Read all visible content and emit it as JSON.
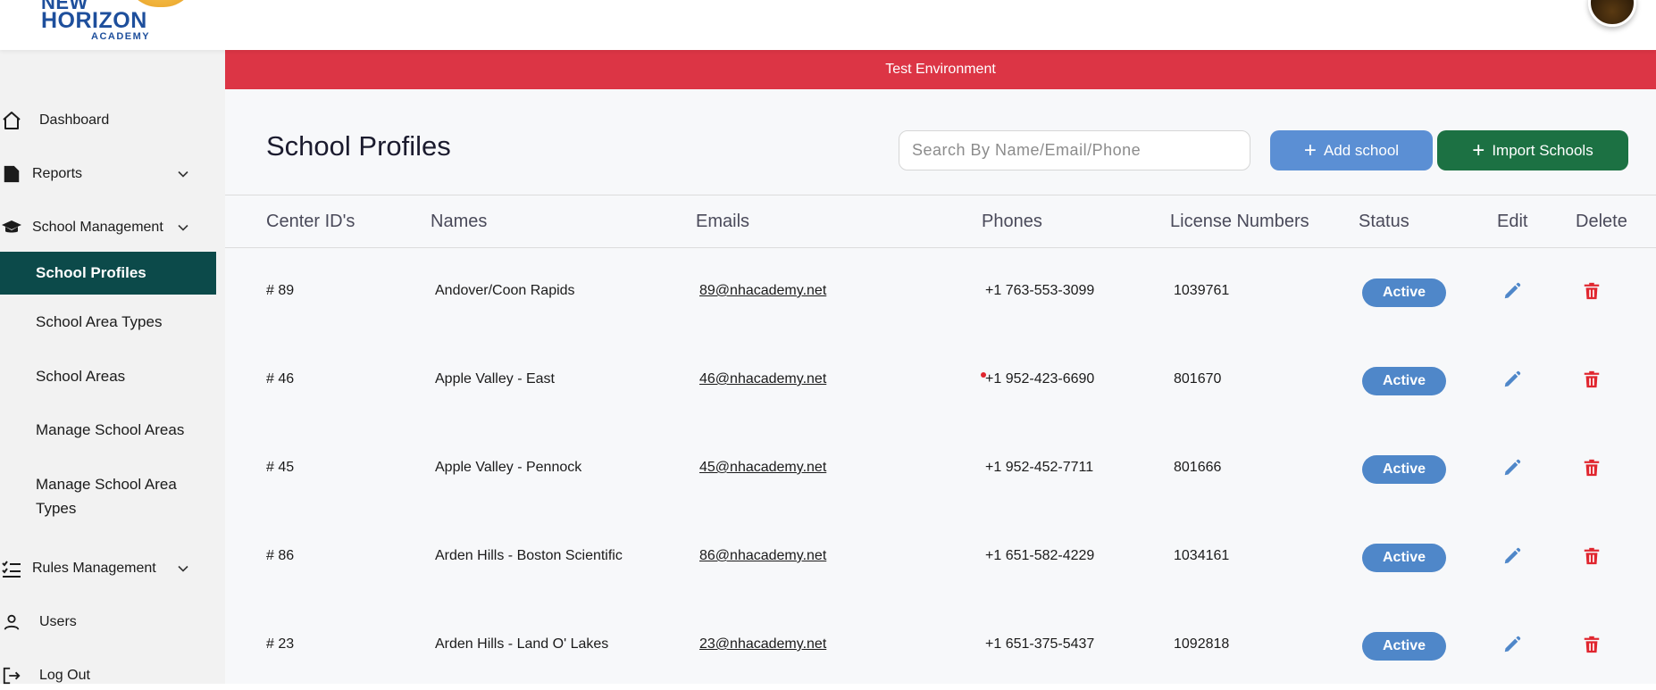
{
  "header": {
    "logo_line1": "NEW",
    "logo_line2": "HORIZON",
    "logo_line3": "ACADEMY"
  },
  "sidebar": {
    "dashboard": "Dashboard",
    "reports": "Reports",
    "school_management": "School Management",
    "sub_items": [
      "School Profiles",
      "School Area Types",
      "School Areas",
      "Manage School Areas",
      "Manage School Area Types"
    ],
    "rules_management": "Rules Management",
    "users": "Users",
    "logout": "Log Out"
  },
  "banner": "Test Environment",
  "page": {
    "title": "School Profiles",
    "search_placeholder": "Search By Name/Email/Phone",
    "add_label": "Add school",
    "import_label": "Import Schools"
  },
  "table": {
    "headers": [
      "Center ID's",
      "Names",
      "Emails",
      "Phones",
      "License Numbers",
      "Status",
      "Edit",
      "Delete"
    ],
    "rows": [
      {
        "id": "# 89",
        "name": "Andover/Coon Rapids",
        "email": "89@nhacademy.net",
        "phone": "+1 763-553-3099",
        "license": "1039761",
        "status": "Active"
      },
      {
        "id": "# 46",
        "name": "Apple Valley - East",
        "email": "46@nhacademy.net",
        "phone": "+1 952-423-6690",
        "license": "801670",
        "status": "Active"
      },
      {
        "id": "# 45",
        "name": "Apple Valley - Pennock",
        "email": "45@nhacademy.net",
        "phone": "+1 952-452-7711",
        "license": "801666",
        "status": "Active"
      },
      {
        "id": "# 86",
        "name": "Arden Hills - Boston Scientific",
        "email": "86@nhacademy.net",
        "phone": "+1 651-582-4229",
        "license": "1034161",
        "status": "Active"
      },
      {
        "id": "# 23",
        "name": "Arden Hills - Land O' Lakes",
        "email": "23@nhacademy.net",
        "phone": "+1 651-375-5437",
        "license": "1092818",
        "status": "Active"
      }
    ]
  },
  "colors": {
    "banner": "#dc3545",
    "active_nav": "#0c4a4a",
    "add_button": "#5b8fd4",
    "import_button": "#1c7143",
    "badge": "#4f87c9",
    "edit_icon": "#4f87c9",
    "delete_icon": "#e0262f"
  },
  "icons": {
    "dashboard": "home-icon",
    "reports": "file-icon",
    "school_management": "graduation-cap-icon",
    "rules_management": "checklist-icon",
    "users": "user-icon",
    "logout": "logout-icon",
    "edit": "pencil-icon",
    "delete": "trash-icon",
    "chevron": "chevron-down-icon"
  }
}
